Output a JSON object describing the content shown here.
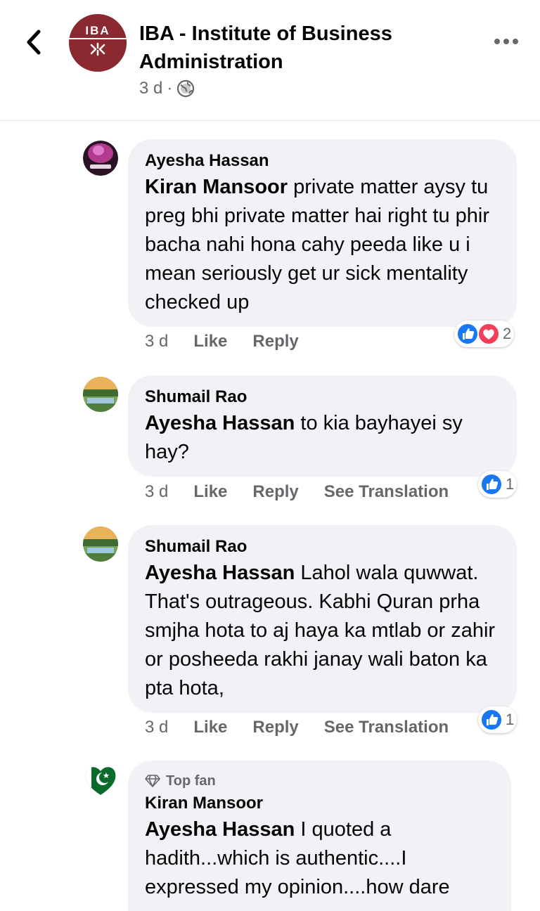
{
  "header": {
    "page_name": "IBA - Institute of Business Administration",
    "logo_text": "IBA",
    "time": "3 d",
    "dot": "·"
  },
  "comments": [
    {
      "author": "Ayesha Hassan",
      "mention": "Kiran Mansoor",
      "text": " private matter aysy tu preg bhi private matter hai right tu phir bacha nahi hona cahy peeda like u i mean seriously get ur sick mentality checked up",
      "time": "3 d",
      "like": "Like",
      "reply": "Reply",
      "reaction_count": "2",
      "reactions": [
        "like-icon",
        "love-icon"
      ]
    },
    {
      "author": "Shumail Rao",
      "mention": "Ayesha Hassan",
      "text": " to kia bayhayei sy hay?",
      "time": "3 d",
      "like": "Like",
      "reply": "Reply",
      "see_translation": "See Translation",
      "reaction_count": "1",
      "reactions": [
        "like-icon"
      ]
    },
    {
      "author": "Shumail Rao",
      "mention": "Ayesha Hassan",
      "text": " Lahol wala quwwat. That's outrageous. Kabhi Quran prha smjha hota to aj haya ka mtlab or zahir or posheeda rakhi janay wali baton ka pta hota,",
      "time": "3 d",
      "like": "Like",
      "reply": "Reply",
      "see_translation": "See Translation",
      "reaction_count": "1",
      "reactions": [
        "like-icon"
      ]
    },
    {
      "badge": "Top fan",
      "author": "Kiran Mansoor",
      "mention": "Ayesha Hassan",
      "text": " I quoted a hadith...which is authentic....I expressed my opinion....how dare"
    }
  ],
  "colors": {
    "like_blue": "#1877f2",
    "love_red": "#f33e58",
    "bubble_bg": "#f0f2f5",
    "secondary_text": "#65676b",
    "logo_bg": "#8a2a30"
  }
}
